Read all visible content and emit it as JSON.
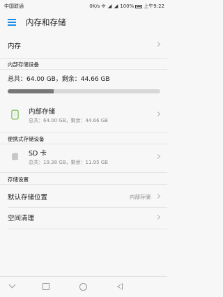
{
  "status_bar": {
    "carrier": "中国联通",
    "network_speed": "0K/s",
    "battery": "100%",
    "time": "上午9:22"
  },
  "app_bar": {
    "title": "内存和存储",
    "menu_icon": "hamburger-menu-icon"
  },
  "memory_row": {
    "label": "内存"
  },
  "internal_section": {
    "header": "内部存储设备",
    "summary": "总共：64.00 GB，剩余：44.66 GB",
    "used_fraction": 0.3,
    "item": {
      "label": "内部存储",
      "detail": "总共：64.00 GB，剩余：44.66 GB",
      "icon": "phone-storage-icon"
    }
  },
  "portable_section": {
    "header": "便携式存储设备",
    "item": {
      "label": "SD 卡",
      "detail": "总共：19.38 GB，剩余：11.95 GB",
      "icon": "sd-card-icon"
    }
  },
  "storage_settings": {
    "header": "存储设置",
    "default_location": {
      "label": "默认存储位置",
      "value": "内部存储"
    },
    "cleanup": {
      "label": "空间清理"
    }
  },
  "colors": {
    "accent": "#1a8ee8",
    "bar_fill": "#777777",
    "bar_track": "#d8d8d8",
    "icon_green": "#7cbf5a"
  }
}
